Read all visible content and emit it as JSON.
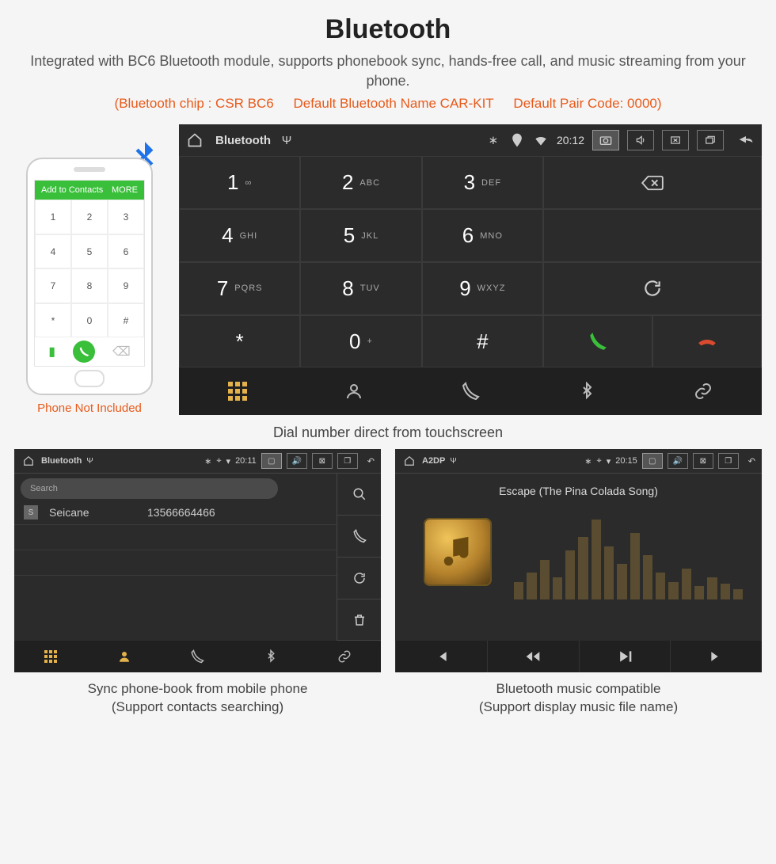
{
  "header": {
    "title": "Bluetooth",
    "subtitle": "Integrated with BC6 Bluetooth module, supports phonebook sync, hands-free call, and music streaming from your phone.",
    "spec_chip": "(Bluetooth chip : CSR BC6",
    "spec_name": "Default Bluetooth Name CAR-KIT",
    "spec_code": "Default Pair Code: 0000)"
  },
  "phone_mock": {
    "contact_bar_left": "Add to Contacts",
    "contact_bar_right": "MORE",
    "caption": "Phone Not Included",
    "keys": [
      "1",
      "2",
      "3",
      "4",
      "5",
      "6",
      "7",
      "8",
      "9",
      "*",
      "0",
      "#"
    ]
  },
  "dialer": {
    "statusbar": {
      "title": "Bluetooth",
      "time": "20:12"
    },
    "keys": [
      {
        "d": "1",
        "l": "∞"
      },
      {
        "d": "2",
        "l": "ABC"
      },
      {
        "d": "3",
        "l": "DEF"
      },
      {
        "d": "4",
        "l": "GHI"
      },
      {
        "d": "5",
        "l": "JKL"
      },
      {
        "d": "6",
        "l": "MNO"
      },
      {
        "d": "7",
        "l": "PQRS"
      },
      {
        "d": "8",
        "l": "TUV"
      },
      {
        "d": "9",
        "l": "WXYZ"
      },
      {
        "d": "*",
        "l": ""
      },
      {
        "d": "0",
        "l": "+"
      },
      {
        "d": "#",
        "l": ""
      }
    ],
    "caption": "Dial number direct from touchscreen"
  },
  "contacts_panel": {
    "statusbar": {
      "title": "Bluetooth",
      "time": "20:11"
    },
    "search_placeholder": "Search",
    "items": [
      {
        "initial": "S",
        "name": "Seicane",
        "number": "13566664466"
      }
    ],
    "caption_line1": "Sync phone-book from mobile phone",
    "caption_line2": "(Support contacts searching)"
  },
  "a2dp_panel": {
    "statusbar": {
      "title": "A2DP",
      "time": "20:15"
    },
    "track": "Escape (The Pina Colada Song)",
    "caption_line1": "Bluetooth music compatible",
    "caption_line2": "(Support display music file name)"
  }
}
